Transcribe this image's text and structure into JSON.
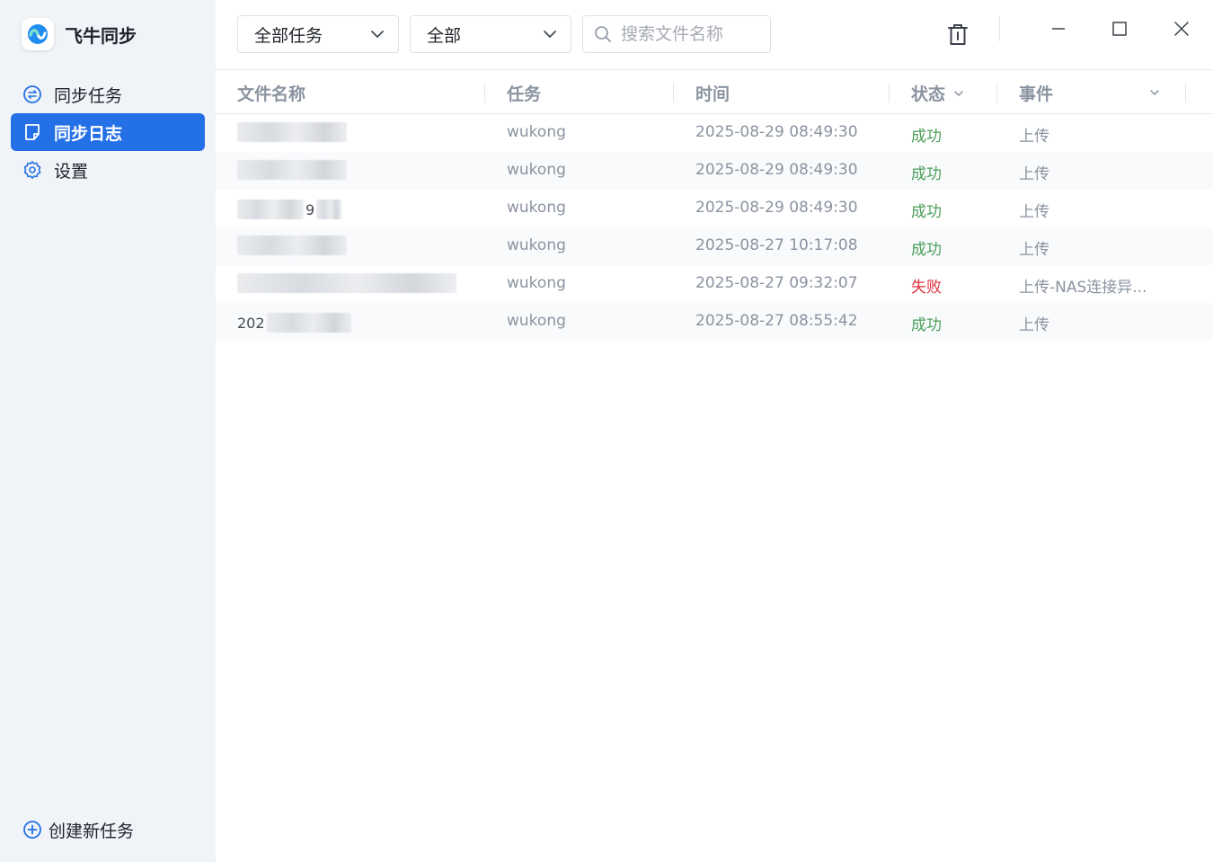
{
  "app": {
    "name": "飞牛同步",
    "colors": {
      "accent": "#2470e6",
      "sidebar_bg": "#f0f3f8",
      "success": "#4c9e5b",
      "fail": "#e0303b"
    }
  },
  "sidebar": {
    "items": [
      {
        "label": "同步任务",
        "icon": "sync-task-icon",
        "active": false
      },
      {
        "label": "同步日志",
        "icon": "log-icon",
        "active": true
      },
      {
        "label": "设置",
        "icon": "gear-icon",
        "active": false
      }
    ],
    "create_label": "创建新任务"
  },
  "toolbar": {
    "task_filter": "全部任务",
    "status_filter": "全部",
    "search_placeholder": "搜索文件名称"
  },
  "table": {
    "columns": [
      "文件名称",
      "任务",
      "时间",
      "状态",
      "事件"
    ],
    "rows": [
      {
        "name_visible": "",
        "task": "wukong",
        "time": "2025-08-29 08:49:30",
        "status": "成功",
        "status_type": "ok",
        "event": "上传"
      },
      {
        "name_visible": "",
        "task": "wukong",
        "time": "2025-08-29 08:49:30",
        "status": "成功",
        "status_type": "ok",
        "event": "上传"
      },
      {
        "name_visible": "9",
        "task": "wukong",
        "time": "2025-08-29 08:49:30",
        "status": "成功",
        "status_type": "ok",
        "event": "上传"
      },
      {
        "name_visible": "",
        "task": "wukong",
        "time": "2025-08-27 10:17:08",
        "status": "成功",
        "status_type": "ok",
        "event": "上传"
      },
      {
        "name_visible": "",
        "task": "wukong",
        "time": "2025-08-27 09:32:07",
        "status": "失败",
        "status_type": "fail",
        "event": "上传-NAS连接异..."
      },
      {
        "name_visible": "202",
        "task": "wukong",
        "time": "2025-08-27 08:55:42",
        "status": "成功",
        "status_type": "ok",
        "event": "上传"
      }
    ]
  }
}
